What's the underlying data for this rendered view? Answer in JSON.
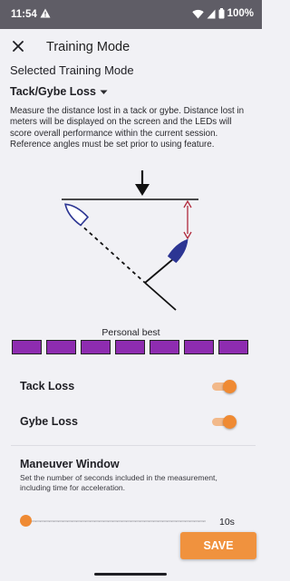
{
  "status_bar": {
    "time": "11:54",
    "battery": "100%",
    "icons": [
      "warning-icon",
      "wifi-icon",
      "signal-icon",
      "battery-icon"
    ]
  },
  "app_bar": {
    "title": "Training Mode",
    "close_icon": "close-icon"
  },
  "selected_mode": {
    "label": "Selected Training Mode",
    "value": "Tack/Gybe Loss",
    "dropdown_icon": "caret-down-icon"
  },
  "description": "Measure the distance lost in a tack or gybe. Distance lost in meters will be displayed on the screen and the LEDs will score overall performance within the current session. Reference angles must be set prior to using feature.",
  "personal_best": {
    "label": "Personal best",
    "bars": 7,
    "bar_color": "#8e2cb0"
  },
  "toggles": [
    {
      "label": "Tack Loss",
      "on": true
    },
    {
      "label": "Gybe Loss",
      "on": true
    }
  ],
  "maneuver_window": {
    "title": "Maneuver Window",
    "description": "Set the number of seconds included in the measurement, including time for acceleration.",
    "value": "10s",
    "slider_fraction": 0
  },
  "save_label": "SAVE",
  "colors": {
    "accent": "#ef8a33",
    "boat": "#2c3593",
    "distance_arrow": "#b0283a",
    "status_bar": "#5f5d66"
  }
}
